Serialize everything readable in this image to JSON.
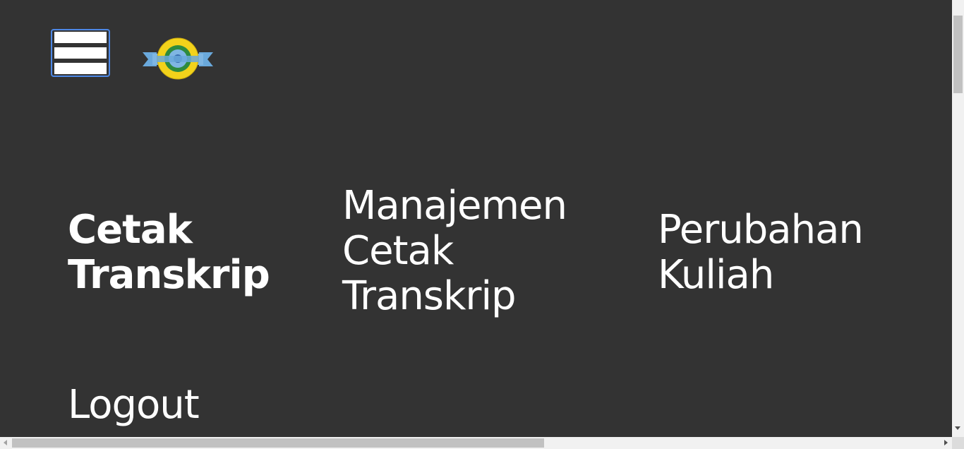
{
  "header": {
    "menu_toggle_icon": "hamburger-icon",
    "logo_icon": "university-seal-icon",
    "logo_colors": {
      "ring": "#f2d21b",
      "ribbon": "#6aa9dc",
      "center": "#2e8b3e"
    },
    "focus_color": "#4d88e6"
  },
  "nav": {
    "items": [
      {
        "label": "Cetak Transkrip",
        "active": true
      },
      {
        "label": "Manajemen Cetak Transkrip",
        "active": false
      },
      {
        "label": "Perubahan Kuliah",
        "active": false
      },
      {
        "label": "Logout",
        "active": false
      }
    ]
  },
  "theme": {
    "background": "#333333",
    "text": "#ffffff"
  }
}
